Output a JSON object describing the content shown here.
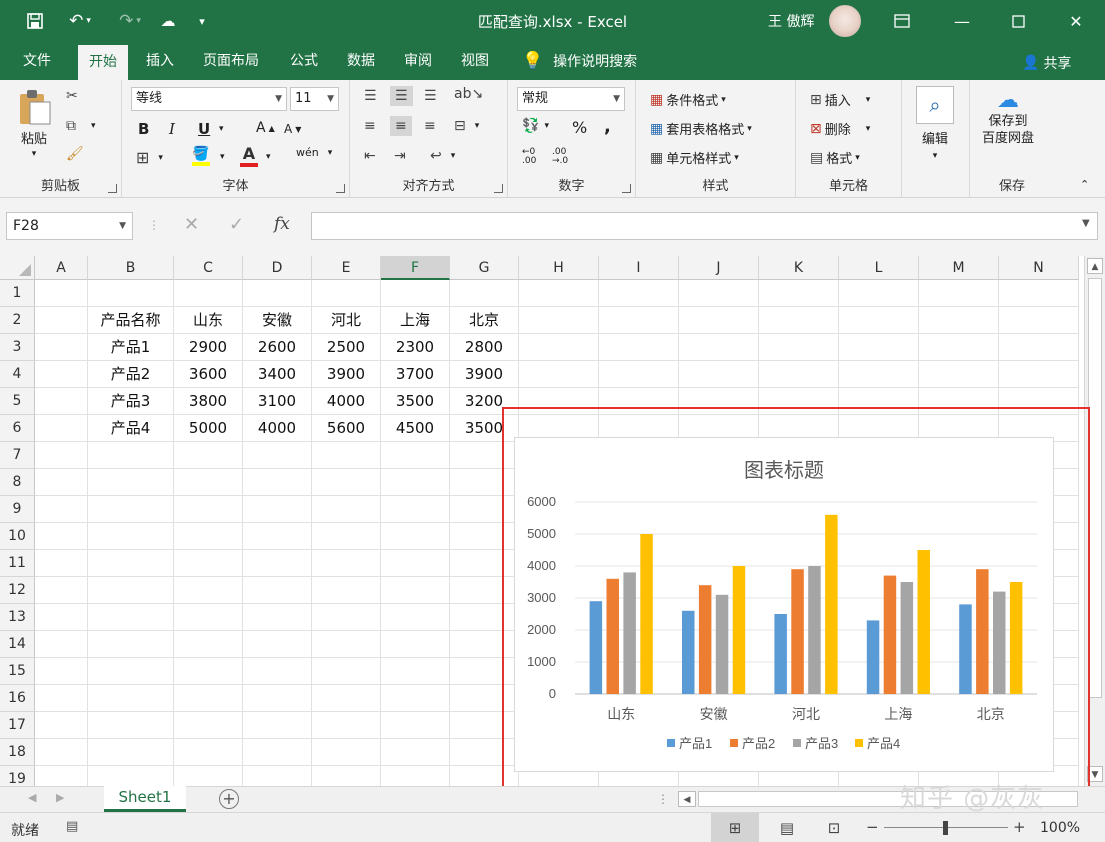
{
  "titlebar": {
    "doc_title": "匹配查询.xlsx  -  Excel",
    "user_name": "王 傲辉",
    "brand_color": "#217346"
  },
  "tabs": [
    {
      "label": "文件",
      "active": false
    },
    {
      "label": "开始",
      "active": true
    },
    {
      "label": "插入",
      "active": false
    },
    {
      "label": "页面布局",
      "active": false
    },
    {
      "label": "公式",
      "active": false
    },
    {
      "label": "数据",
      "active": false
    },
    {
      "label": "审阅",
      "active": false
    },
    {
      "label": "视图",
      "active": false
    }
  ],
  "tell_me": "操作说明搜索",
  "share": "共享",
  "ribbon": {
    "clipboard": {
      "label": "剪贴板",
      "paste": "粘贴"
    },
    "font": {
      "label": "字体",
      "font_name": "等线",
      "font_size": "11",
      "bold": "B",
      "italic": "I",
      "underline": "U"
    },
    "alignment": {
      "label": "对齐方式"
    },
    "number": {
      "label": "数字",
      "format": "常规",
      "percent": "%",
      "comma": ","
    },
    "styles": {
      "label": "样式",
      "conditional": "条件格式",
      "table": "套用表格格式",
      "cell_styles": "单元格样式"
    },
    "cells": {
      "label": "单元格",
      "insert": "插入",
      "delete": "删除",
      "format": "格式"
    },
    "editing": {
      "label": "编辑"
    },
    "save": {
      "label": "保存",
      "button": "保存到\n百度网盘"
    }
  },
  "formula_bar": {
    "name_box": "F28",
    "formula": ""
  },
  "columns": [
    "A",
    "B",
    "C",
    "D",
    "E",
    "F",
    "G",
    "H",
    "I",
    "J",
    "K",
    "L",
    "M",
    "N"
  ],
  "selected_column": "F",
  "rows": [
    "1",
    "2",
    "3",
    "4",
    "5",
    "6",
    "7",
    "8",
    "9",
    "10",
    "11",
    "12",
    "13",
    "14",
    "15",
    "16",
    "17",
    "18",
    "19"
  ],
  "table": {
    "header": [
      "产品名称",
      "山东",
      "安徽",
      "河北",
      "上海",
      "北京"
    ],
    "rows": [
      [
        "产品1",
        "2900",
        "2600",
        "2500",
        "2300",
        "2800"
      ],
      [
        "产品2",
        "3600",
        "3400",
        "3900",
        "3700",
        "3900"
      ],
      [
        "产品3",
        "3800",
        "3100",
        "4000",
        "3500",
        "3200"
      ],
      [
        "产品4",
        "5000",
        "4000",
        "5600",
        "4500",
        "3500"
      ]
    ]
  },
  "chart_data": {
    "type": "bar",
    "title": "图表标题",
    "categories": [
      "山东",
      "安徽",
      "河北",
      "上海",
      "北京"
    ],
    "series": [
      {
        "name": "产品1",
        "values": [
          2900,
          2600,
          2500,
          2300,
          2800
        ],
        "color": "#5b9bd5"
      },
      {
        "name": "产品2",
        "values": [
          3600,
          3400,
          3900,
          3700,
          3900
        ],
        "color": "#ed7d31"
      },
      {
        "name": "产品3",
        "values": [
          3800,
          3100,
          4000,
          3500,
          3200
        ],
        "color": "#a5a5a5"
      },
      {
        "name": "产品4",
        "values": [
          5000,
          4000,
          5600,
          4500,
          3500
        ],
        "color": "#ffc000"
      }
    ],
    "ylim": [
      0,
      6000
    ],
    "yticks": [
      "0",
      "1000",
      "2000",
      "3000",
      "4000",
      "5000",
      "6000"
    ],
    "grid": true,
    "legend": "bottom"
  },
  "sheet_tabs": [
    {
      "label": "Sheet1",
      "active": true
    }
  ],
  "status": {
    "ready": "就绪",
    "zoom": "100%"
  },
  "watermark": "知乎 @灰灰"
}
